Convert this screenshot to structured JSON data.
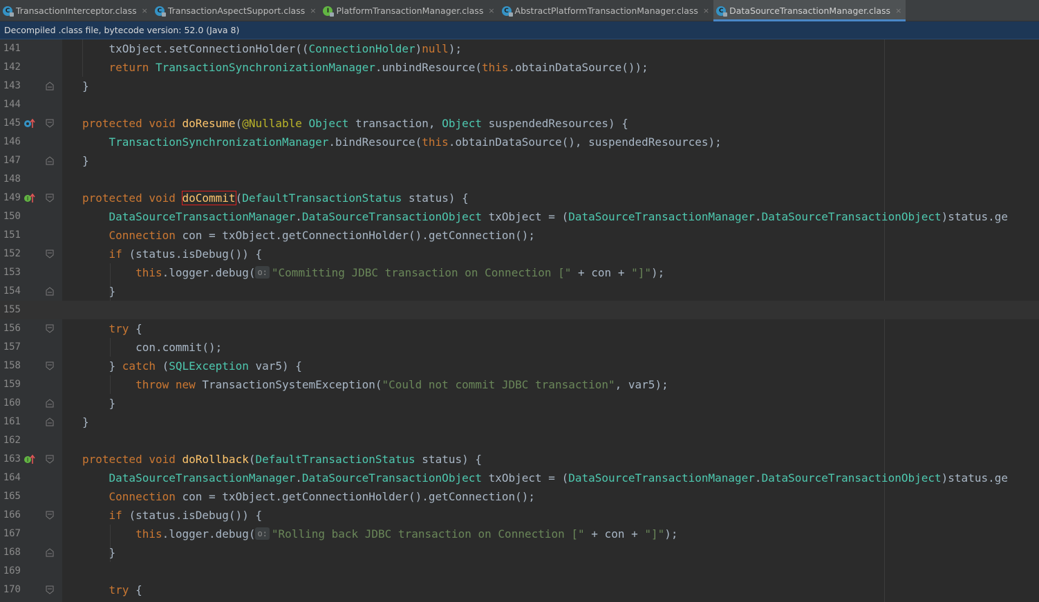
{
  "tabs": [
    {
      "label": "TransactionInterceptor.class",
      "icon": "class-icon"
    },
    {
      "label": "TransactionAspectSupport.class",
      "icon": "class-icon"
    },
    {
      "label": "PlatformTransactionManager.class",
      "icon": "interface-icon"
    },
    {
      "label": "AbstractPlatformTransactionManager.class",
      "icon": "abstract-class-icon"
    },
    {
      "label": "DataSourceTransactionManager.class",
      "icon": "class-icon",
      "active": true
    }
  ],
  "tab_close_glyph": "×",
  "banner": {
    "text": "Decompiled .class file, bytecode version: 52.0 (Java 8)"
  },
  "lines": [
    {
      "num": "141"
    },
    {
      "num": "142"
    },
    {
      "num": "143"
    },
    {
      "num": "144"
    },
    {
      "num": "145"
    },
    {
      "num": "146"
    },
    {
      "num": "147"
    },
    {
      "num": "148"
    },
    {
      "num": "149"
    },
    {
      "num": "150"
    },
    {
      "num": "151"
    },
    {
      "num": "152"
    },
    {
      "num": "153"
    },
    {
      "num": "154"
    },
    {
      "num": "155"
    },
    {
      "num": "156"
    },
    {
      "num": "157"
    },
    {
      "num": "158"
    },
    {
      "num": "159"
    },
    {
      "num": "160"
    },
    {
      "num": "161"
    },
    {
      "num": "162"
    },
    {
      "num": "163"
    },
    {
      "num": "164"
    },
    {
      "num": "165"
    },
    {
      "num": "166"
    },
    {
      "num": "167"
    },
    {
      "num": "168"
    },
    {
      "num": "169"
    },
    {
      "num": "170"
    }
  ],
  "code": {
    "l141": {
      "a": "    txObject",
      "b": ".setConnectionHolder((",
      "c": "ConnectionHolder",
      "d": ")",
      "e": "null",
      "f": ");"
    },
    "l142": {
      "a": "    ",
      "b": "return ",
      "c": "TransactionSynchronizationManager",
      "d": ".unbindResource(",
      "e": "this",
      "f": ".obtainDataSource());"
    },
    "l143": {
      "a": "}"
    },
    "l145": {
      "a": "protected void ",
      "b": "doResume",
      "c": "(",
      "d": "@Nullable ",
      "e": "Object ",
      "f": "transaction, ",
      "g": "Object ",
      "h": "suspendedResources) {"
    },
    "l146": {
      "a": "    ",
      "b": "TransactionSynchronizationManager",
      "c": ".bindResource(",
      "d": "this",
      "e": ".obtainDataSource(), suspendedResources);"
    },
    "l147": {
      "a": "}"
    },
    "l149": {
      "a": "protected void ",
      "b": "doCommit",
      "c": "(",
      "d": "DefaultTransactionStatus ",
      "e": "status) {"
    },
    "l150": {
      "a": "    ",
      "b": "DataSourceTransactionManager",
      "c": ".",
      "d": "DataSourceTransactionObject ",
      "e": "txObject = (",
      "f": "DataSourceTransactionManager",
      "g": ".",
      "h": "DataSourceTransactionObject",
      "i": ")status.ge"
    },
    "l151": {
      "a": "    ",
      "b": "Connection ",
      "c": "con = txObject.getConnectionHolder().getConnection();"
    },
    "l152": {
      "a": "    ",
      "b": "if ",
      "c": "(status.isDebug()) {"
    },
    "l153": {
      "a": "        ",
      "b": "this",
      "c": ".logger.debug(",
      "d": "o:",
      "e": "\"Committing JDBC transaction on Connection [\"",
      "f": " + con + ",
      "g": "\"]\"",
      "h": ");"
    },
    "l154": {
      "a": "    }"
    },
    "l156": {
      "a": "    ",
      "b": "try ",
      "c": "{"
    },
    "l157": {
      "a": "        con.commit();"
    },
    "l158": {
      "a": "    } ",
      "b": "catch ",
      "c": "(",
      "d": "SQLException ",
      "e": "var5) {"
    },
    "l159": {
      "a": "        ",
      "b": "throw new ",
      "c": "TransactionSystemException(",
      "d": "\"Could not commit JDBC transaction\"",
      "e": ", var5);"
    },
    "l160": {
      "a": "    }"
    },
    "l161": {
      "a": "}"
    },
    "l163": {
      "a": "protected void ",
      "b": "doRollback",
      "c": "(",
      "d": "DefaultTransactionStatus ",
      "e": "status) {"
    },
    "l164": {
      "a": "    ",
      "b": "DataSourceTransactionManager",
      "c": ".",
      "d": "DataSourceTransactionObject ",
      "e": "txObject = (",
      "f": "DataSourceTransactionManager",
      "g": ".",
      "h": "DataSourceTransactionObject",
      "i": ")status.ge"
    },
    "l165": {
      "a": "    ",
      "b": "Connection ",
      "c": "con = txObject.getConnectionHolder().getConnection();"
    },
    "l166": {
      "a": "    ",
      "b": "if ",
      "c": "(status.isDebug()) {"
    },
    "l167": {
      "a": "        ",
      "b": "this",
      "c": ".logger.debug(",
      "d": "o:",
      "e": "\"Rolling back JDBC transaction on Connection [\"",
      "f": " + con + ",
      "g": "\"]\"",
      "h": ");"
    },
    "l168": {
      "a": "    }"
    },
    "l170": {
      "a": "    ",
      "b": "try ",
      "c": "{"
    }
  },
  "colors": {
    "accent": "#4a88c7",
    "highlight_box": "#e02020",
    "banner_bg": "#1d3756"
  }
}
